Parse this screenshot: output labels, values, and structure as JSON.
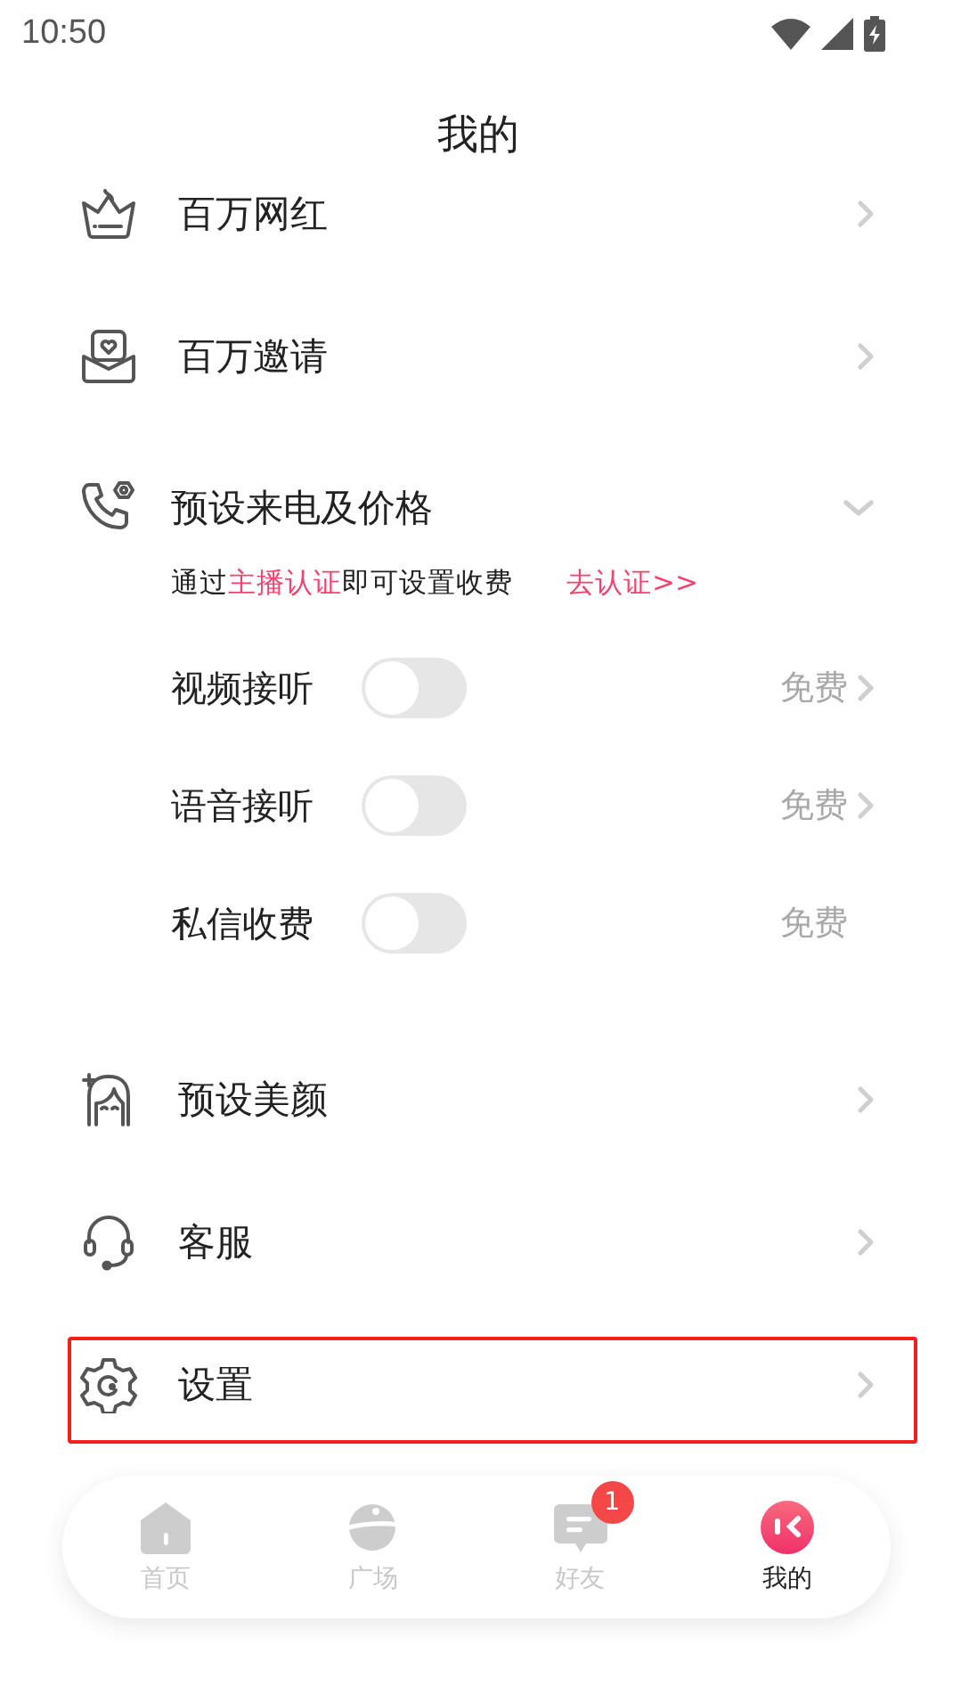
{
  "status_bar": {
    "time": "10:50"
  },
  "header": {
    "title": "我的"
  },
  "menu": [
    {
      "kind": "link",
      "label": "百万网红",
      "highlighted": false
    },
    {
      "kind": "link",
      "label": "百万邀请",
      "highlighted": false
    },
    {
      "kind": "expandable",
      "label": "预设来电及价格",
      "expanded": true,
      "notice": [
        {
          "text": "通过",
          "accent": false
        },
        {
          "text": "主播认证",
          "accent": true
        },
        {
          "text": "即可设置收费",
          "accent": false
        }
      ],
      "action": "去认证>>",
      "options": [
        {
          "label": "视频接听",
          "on": false,
          "price": "免费",
          "has_arrow": true
        },
        {
          "label": "语音接听",
          "on": false,
          "price": "免费",
          "has_arrow": true
        },
        {
          "label": "私信收费",
          "on": false,
          "price": "免费",
          "has_arrow": false
        }
      ]
    },
    {
      "kind": "link",
      "label": "预设美颜",
      "highlighted": false
    },
    {
      "kind": "link",
      "label": "客服",
      "highlighted": false
    },
    {
      "kind": "link",
      "label": "设置",
      "highlighted": true
    }
  ],
  "nav": [
    {
      "label": "首页",
      "selected": false
    },
    {
      "label": "广场",
      "selected": false
    },
    {
      "label": "好友",
      "selected": false,
      "badge": "1"
    },
    {
      "label": "我的",
      "selected": true
    }
  ]
}
